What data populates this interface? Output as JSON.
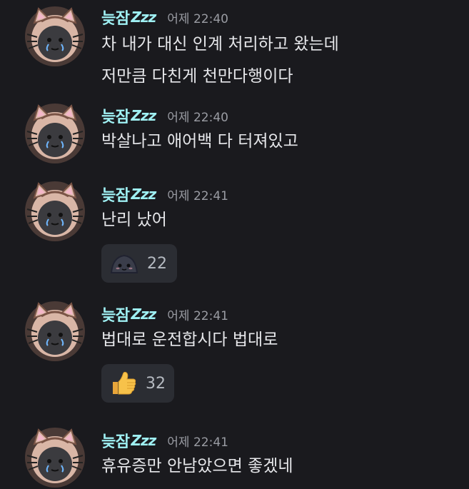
{
  "messages": [
    {
      "username": "늦잠",
      "badge": "Zzz",
      "timestamp": "어제 22:40",
      "lines": [
        "차 내가 대신 인계 처리하고 왔는데",
        "저만큼 다친게 천만다행이다"
      ]
    },
    {
      "username": "늦잠",
      "badge": "Zzz",
      "timestamp": "어제 22:40",
      "lines": [
        "박살나고 애어백 다 터져있고"
      ]
    },
    {
      "username": "늦잠",
      "badge": "Zzz",
      "timestamp": "어제 22:41",
      "lines": [
        "난리 났어"
      ],
      "reaction": {
        "emoji": "blob-emoji",
        "count": "22"
      }
    },
    {
      "username": "늦잠",
      "badge": "Zzz",
      "timestamp": "어제 22:41",
      "lines": [
        "법대로 운전합시다 법대로"
      ],
      "reaction": {
        "emoji": "thumbs-up-emoji",
        "count": "32"
      }
    },
    {
      "username": "늦잠",
      "badge": "Zzz",
      "timestamp": "어제 22:41",
      "lines": [
        "휴유증만 안남았으면 좋겠네"
      ]
    }
  ],
  "colors": {
    "background": "#1a1a1e",
    "username": "#9ff0f3",
    "timestamp": "#9a9ca3",
    "text": "#e6e7ea",
    "reaction_bg": "#2b2d33"
  }
}
